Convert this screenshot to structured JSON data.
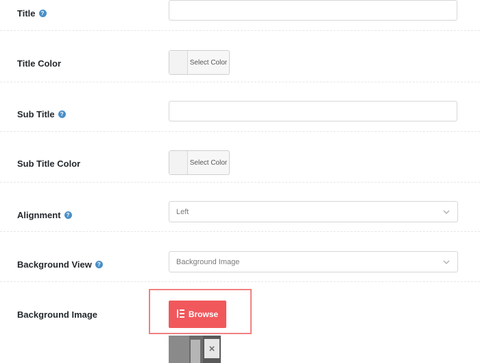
{
  "fields": {
    "title": {
      "label": "Title",
      "help": "?",
      "value": ""
    },
    "title_color": {
      "label": "Title Color",
      "button": "Select Color"
    },
    "sub_title": {
      "label": "Sub Title",
      "help": "?",
      "value": ""
    },
    "sub_title_color": {
      "label": "Sub Title Color",
      "button": "Select Color"
    },
    "alignment": {
      "label": "Alignment",
      "help": "?",
      "selected": "Left"
    },
    "background_view": {
      "label": "Background View",
      "help": "?",
      "selected": "Background Image"
    },
    "background_image": {
      "label": "Background Image",
      "button": "Browse",
      "remove": "×"
    }
  },
  "colors": {
    "accent": "#f0585c",
    "highlight": "#f08080",
    "help_icon": "#4a90c8"
  },
  "icons": {
    "help": "question-circle-icon",
    "chevron": "chevron-down-icon",
    "browse": "elementor-icon",
    "remove": "close-icon"
  }
}
